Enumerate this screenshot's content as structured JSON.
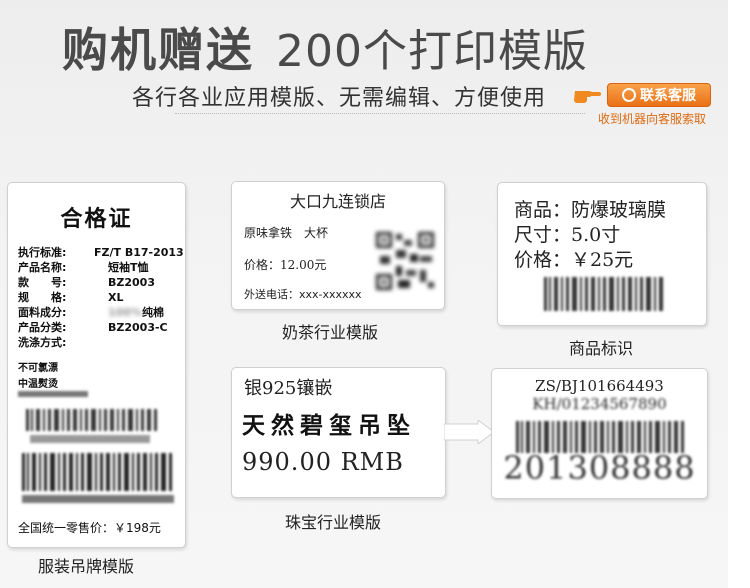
{
  "header": {
    "headline_a": "购机赠送",
    "headline_b": "200个打印模版",
    "subtitle": "各行各业应用模版、无需编辑、方便使用",
    "contact_button": "联系客服",
    "contact_note": "收到机器向客服索取"
  },
  "garment": {
    "title": "合格证",
    "rows": [
      {
        "k": "执行标准:",
        "v": "FZ/T B17-2013"
      },
      {
        "k": "产品名称:",
        "v": "短袖T恤"
      },
      {
        "k": "款　　号:",
        "v": "BZ2003"
      },
      {
        "k": "规　　格:",
        "v": "XL"
      },
      {
        "k": "面料成分:",
        "v": "纯棉"
      },
      {
        "k": "产品分类:",
        "v": "BZ2003-C"
      },
      {
        "k": "洗涤方式:",
        "v": ""
      }
    ],
    "wash1": "不可氯漂",
    "wash2": "中温熨烫",
    "price": "全国统一零售价：￥198元",
    "caption": "服装吊牌模版"
  },
  "tea": {
    "title": "大口九连锁店",
    "item": "原味拿铁　大杯",
    "price": "价格：12.00元",
    "phone": "外送电话：xxx-xxxxxx",
    "caption": "奶茶行业模版"
  },
  "product": {
    "name": "商品：防爆玻璃膜",
    "size": "尺寸：5.0寸",
    "price": "价格：￥25元",
    "caption": "商品标识"
  },
  "jewelry": {
    "line1": "银925镶嵌",
    "line2": "天然碧玺吊坠",
    "line3": "990.00 RMB",
    "caption": "珠宝行业模版"
  },
  "serial": {
    "line1": "ZS/BJ101664493",
    "line2": "KH/01234567890",
    "number": "201308888"
  },
  "colors": {
    "accent": "#ea7016",
    "text": "#4a4a4a"
  }
}
